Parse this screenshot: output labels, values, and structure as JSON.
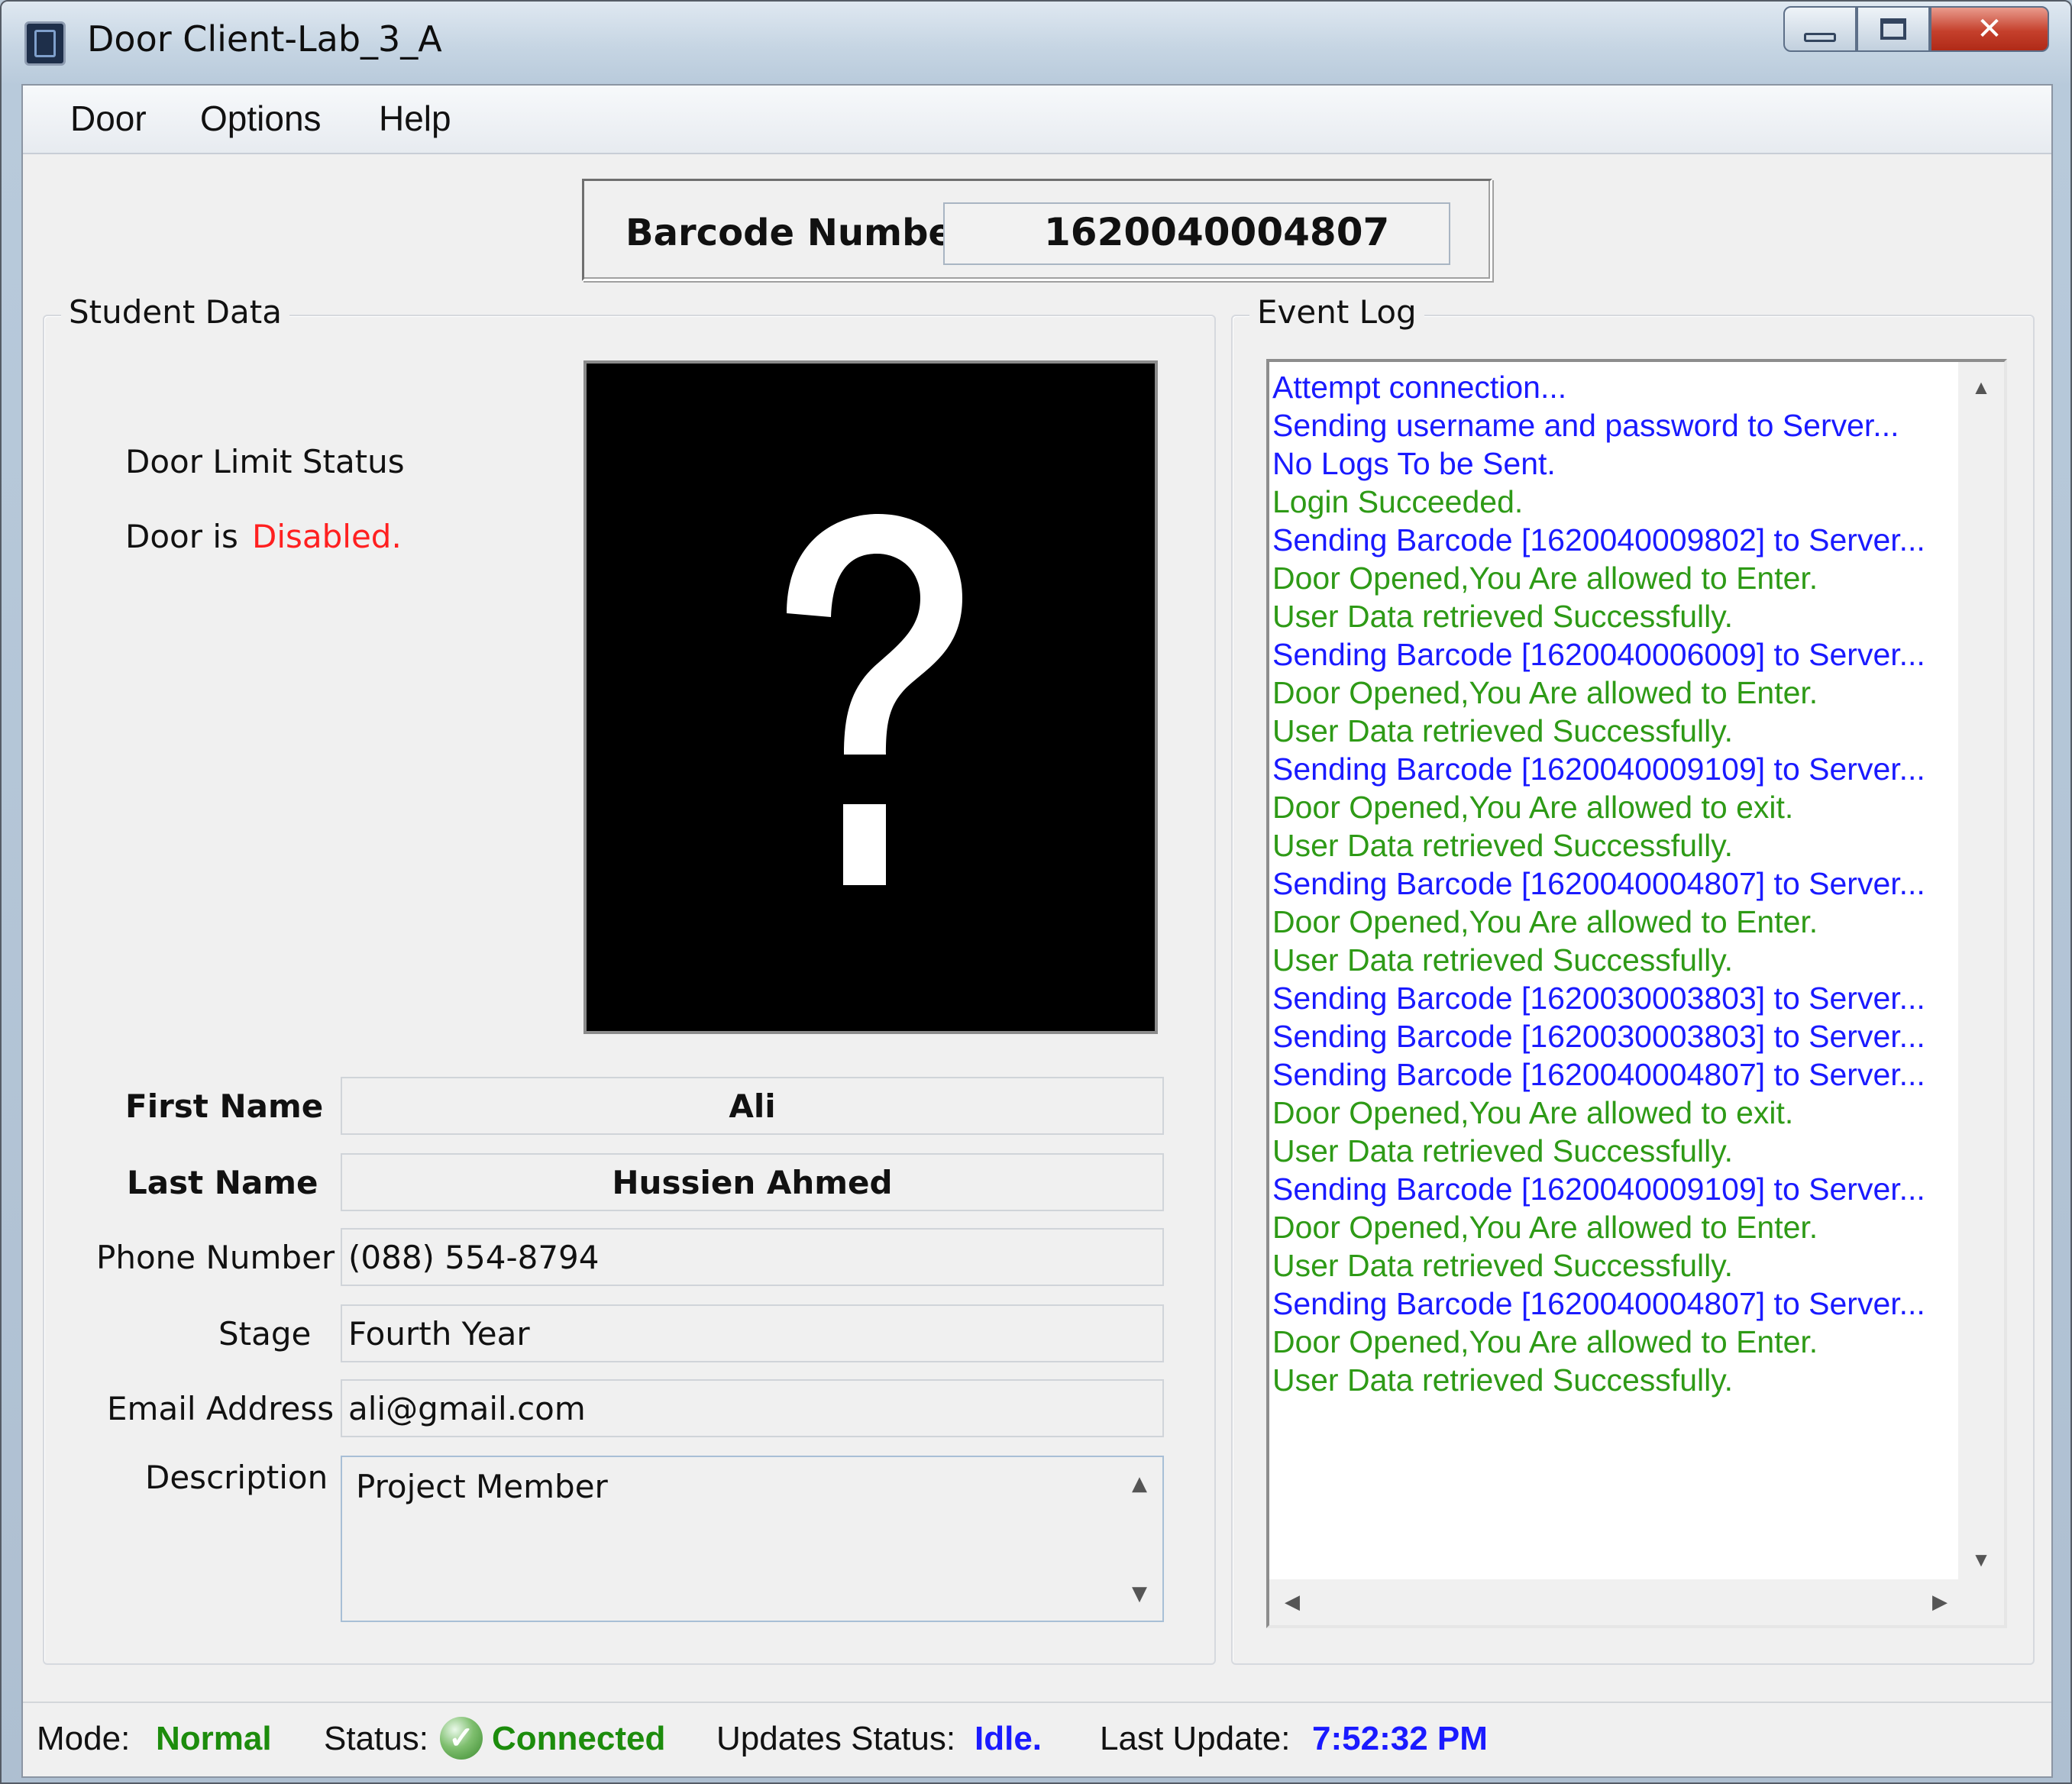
{
  "window": {
    "title": "Door Client-Lab_3_A"
  },
  "menu": [
    "Door",
    "Options",
    "Help"
  ],
  "barcode": {
    "label": "Barcode Number",
    "value": "1620040004807"
  },
  "student": {
    "group_title": "Student Data",
    "door_limit_label": "Door Limit Status",
    "door_is_label": "Door is",
    "door_state": "Disabled.",
    "fields": [
      {
        "label": "First Name",
        "value": "Ali"
      },
      {
        "label": "Last Name",
        "value": "Hussien Ahmed"
      },
      {
        "label": "Phone Number",
        "value": "(088) 554-8794"
      },
      {
        "label": "Stage",
        "value": "Fourth Year"
      },
      {
        "label": "Email Address",
        "value": "ali@gmail.com"
      },
      {
        "label": "Description",
        "value": "Project Member"
      }
    ]
  },
  "event_log": {
    "group_title": "Event Log",
    "lines": [
      {
        "text": "Attempt connection...",
        "color": "#1a1aff"
      },
      {
        "text": "Sending username and password to Server...",
        "color": "#1a1aff"
      },
      {
        "text": "No Logs To be Sent.",
        "color": "#1a1aff"
      },
      {
        "text": "Login Succeeded.",
        "color": "#2e9a16"
      },
      {
        "text": "Sending Barcode [1620040009802] to Server...",
        "color": "#1a1aff"
      },
      {
        "text": "Door Opened,You Are allowed to Enter.",
        "color": "#2e9a16"
      },
      {
        "text": "User Data retrieved Successfully.",
        "color": "#2e9a16"
      },
      {
        "text": "Sending Barcode [1620040006009] to Server...",
        "color": "#1a1aff"
      },
      {
        "text": "Door Opened,You Are allowed to Enter.",
        "color": "#2e9a16"
      },
      {
        "text": "User Data retrieved Successfully.",
        "color": "#2e9a16"
      },
      {
        "text": "Sending Barcode [1620040009109] to Server...",
        "color": "#1a1aff"
      },
      {
        "text": "Door Opened,You Are allowed to exit.",
        "color": "#2e9a16"
      },
      {
        "text": "User Data retrieved Successfully.",
        "color": "#2e9a16"
      },
      {
        "text": "Sending Barcode [1620040004807] to Server...",
        "color": "#1a1aff"
      },
      {
        "text": "Door Opened,You Are allowed to Enter.",
        "color": "#2e9a16"
      },
      {
        "text": "User Data retrieved Successfully.",
        "color": "#2e9a16"
      },
      {
        "text": "Sending Barcode [1620030003803] to Server...",
        "color": "#1a1aff"
      },
      {
        "text": "Sending Barcode [1620030003803] to Server...",
        "color": "#1a1aff"
      },
      {
        "text": "Sending Barcode [1620040004807] to Server...",
        "color": "#1a1aff"
      },
      {
        "text": "Door Opened,You Are allowed to exit.",
        "color": "#2e9a16"
      },
      {
        "text": "User Data retrieved Successfully.",
        "color": "#2e9a16"
      },
      {
        "text": "Sending Barcode [1620040009109] to Server...",
        "color": "#1a1aff"
      },
      {
        "text": "Door Opened,You Are allowed to Enter.",
        "color": "#2e9a16"
      },
      {
        "text": "User Data retrieved Successfully.",
        "color": "#2e9a16"
      },
      {
        "text": "Sending Barcode [1620040004807] to Server...",
        "color": "#1a1aff"
      },
      {
        "text": "Door Opened,You Are allowed to Enter.",
        "color": "#2e9a16"
      },
      {
        "text": "User Data retrieved Successfully.",
        "color": "#2e9a16"
      }
    ]
  },
  "status_bar": {
    "mode_label": "Mode:",
    "mode_value": "Normal",
    "status_label": "Status:",
    "status_value": "Connected",
    "updates_label": "Updates Status:",
    "updates_value": "Idle.",
    "last_update_label": "Last Update:",
    "last_update_value": "7:52:32 PM"
  },
  "colors": {
    "disabled_red": "#ff2020",
    "status_green": "#1c8c0c",
    "status_blue": "#1a1aff"
  },
  "icons": {
    "app": "door-client-icon",
    "photo_placeholder": "question-mark-icon",
    "connected": "check-icon"
  }
}
